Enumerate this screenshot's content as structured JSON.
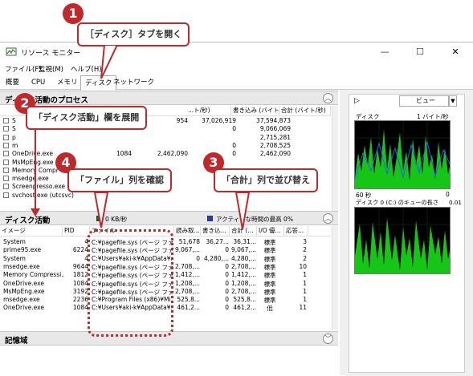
{
  "window": {
    "title": "リソース モニター",
    "controls": [
      "—",
      "☐",
      "✕"
    ]
  },
  "menu": [
    "ファイル(F)",
    "監視(M)",
    "ヘルプ(H)"
  ],
  "tabs": [
    "概要",
    "CPU",
    "メモリ",
    "ディスク",
    "ネットワーク"
  ],
  "process_section": {
    "title": "ディスク活動のプロセス",
    "cols": [
      "合計 (バイト/秒)",
      "書き込み (バイト/...",
      "...ト/秒)"
    ],
    "rows": [
      {
        "name": "S",
        "c1": "",
        "c2": "954",
        "c3": "37,026,919",
        "c4": "37,594,873"
      },
      {
        "name": "S",
        "c1": "",
        "c2": "",
        "c3": "0",
        "c4": "9,066,069"
      },
      {
        "name": "p",
        "c1": "",
        "c2": "",
        "c3": "",
        "c4": "2,715,281"
      },
      {
        "name": "m",
        "c1": "",
        "c2": "",
        "c3": "0",
        "c4": "2,708,525"
      },
      {
        "name": "OneDrive.exe",
        "c1": "1084",
        "c2": "2,462,090",
        "c3": "0",
        "c4": "2,462,090"
      },
      {
        "name": "MsMpEng.exe",
        "c1": "",
        "c2": "",
        "c3": "",
        "c4": ""
      },
      {
        "name": "Memory Compr",
        "c1": "",
        "c2": "",
        "c3": "",
        "c4": ""
      },
      {
        "name": "msedge.exe",
        "c1": "",
        "c2": "",
        "c3": "",
        "c4": ""
      },
      {
        "name": "Screenpresso.exe",
        "c1": "",
        "c2": "",
        "c3": "",
        "c4": ""
      },
      {
        "name": "svchost.exe (utcsvc)",
        "c1": "",
        "c2": "",
        "c3": "",
        "c4": ""
      }
    ]
  },
  "disk_section": {
    "title": "ディスク活動",
    "legend1": "0 KB/秒",
    "legend2": "アクティブな時間の最高 0%",
    "cols": [
      "イメージ",
      "PID",
      "ファイル",
      "読み取...",
      "書き込...",
      "合計 (...",
      "I/O 優...",
      "応答..."
    ],
    "rows": [
      {
        "image": "System",
        "pid": "4",
        "file": "C:¥pagefile.sys (ページ ファ...",
        "read": "51,678",
        "write": "36,27...",
        "total": "36,31...",
        "io": "標準",
        "resp": "3"
      },
      {
        "image": "prime95.exe",
        "pid": "6224",
        "file": "C:¥pagefile.sys (ページ ファ...",
        "read": "9,067,...",
        "write": "0",
        "total": "9,067,...",
        "io": "標準",
        "resp": "2"
      },
      {
        "image": "System",
        "pid": "4",
        "file": "C:¥Users¥aki-k¥AppData¥...",
        "read": "0",
        "write": "4,280,...",
        "total": "4,280,...",
        "io": "標準",
        "resp": "2"
      },
      {
        "image": "msedge.exe",
        "pid": "9644",
        "file": "C:¥pagefile.sys (ページ ファ...",
        "read": "2,708,...",
        "write": "0",
        "total": "2,708,...",
        "io": "標準",
        "resp": "10"
      },
      {
        "image": "Memory Compressi...",
        "pid": "1812",
        "file": "C:¥pagefile.sys (ページ ファ...",
        "read": "1,412,...",
        "write": "0",
        "total": "1,412,...",
        "io": "標準",
        "resp": "1"
      },
      {
        "image": "OneDrive.exe",
        "pid": "1084",
        "file": "C:¥pagefile.sys (ページ ファ...",
        "read": "1,208,...",
        "write": "0",
        "total": "1,208,...",
        "io": "標準",
        "resp": "1"
      },
      {
        "image": "MsMpEng.exe",
        "pid": "3192",
        "file": "C:¥pagefile.sys (ページ ファ...",
        "read": "2,708,...",
        "write": "0",
        "total": "2,708,...",
        "io": "標準",
        "resp": "1"
      },
      {
        "image": "msedge.exe",
        "pid": "2236",
        "file": "C:¥Program Files (x86)¥Mi...",
        "read": "525,8...",
        "write": "0",
        "total": "525,8...",
        "io": "標準",
        "resp": "1"
      },
      {
        "image": "OneDrive.exe",
        "pid": "1084",
        "file": "C:¥Users¥aki-k¥AppData¥...",
        "read": "461,2...",
        "write": "0",
        "total": "461,2...",
        "io": "低",
        "resp": "11"
      }
    ]
  },
  "storage_section": {
    "title": "記憶域"
  },
  "right_panel": {
    "view_label": "ビュー",
    "disk_label": "ディスク",
    "disk_unit": "1 バイト/秒",
    "time_left": "60 秒",
    "time_right": "0",
    "queue_label": "ディスク 0 (C:) のキューの長さ",
    "queue_val": "0.01"
  },
  "callouts": {
    "c1": {
      "num": "1",
      "text": "［ディスク］タブを開く"
    },
    "c2": {
      "num": "2",
      "text": "「ディスク活動」欄を展開"
    },
    "c3": {
      "num": "3",
      "text": "「合計」列で並び替え"
    },
    "c4": {
      "num": "4",
      "text": "「ファイル」列を確認"
    }
  },
  "colors": {
    "callout_red": "#c0282a",
    "graph_green": "#16c616",
    "graph_blue": "#2a5cff"
  }
}
